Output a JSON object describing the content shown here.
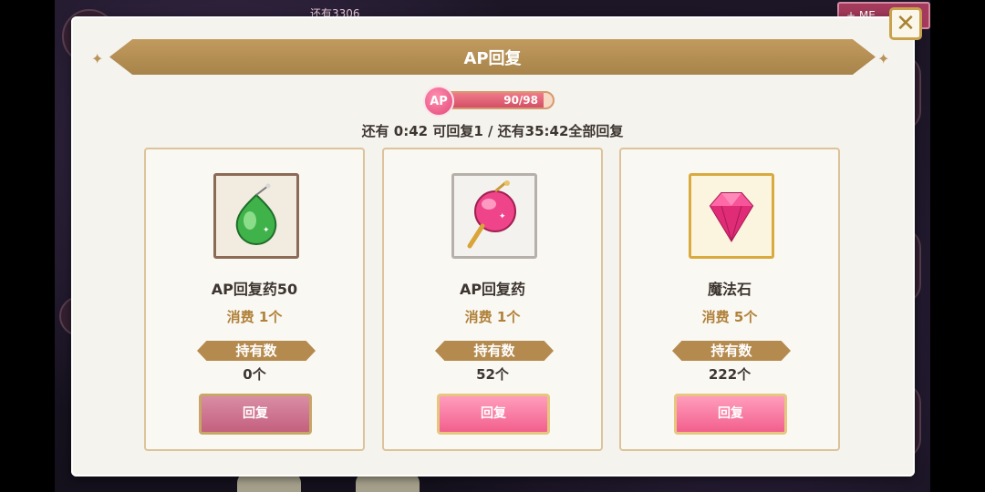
{
  "background": {
    "top_text": "还有3306",
    "tag_text": "+ ME"
  },
  "dialog": {
    "title": "AP回复",
    "ap": {
      "badge": "AP",
      "value_text": "90/98",
      "current": 90,
      "max": 98
    },
    "recover_info": "还有 0:42 可回复1 / 还有35:42全部回复",
    "close_glyph": "✕",
    "items": [
      {
        "name": "AP回复药50",
        "cost": "消费 1个",
        "own_label": "持有数",
        "own_count": "0个",
        "button": "回复",
        "icon": "green-potion-icon",
        "button_state": "disabled"
      },
      {
        "name": "AP回复药",
        "cost": "消费 1个",
        "own_label": "持有数",
        "own_count": "52个",
        "button": "回复",
        "icon": "pink-potion-icon",
        "button_state": "enabled"
      },
      {
        "name": "魔法石",
        "cost": "消费 5个",
        "own_label": "持有数",
        "own_count": "222个",
        "button": "回复",
        "icon": "magic-stone-icon",
        "button_state": "enabled"
      }
    ]
  },
  "colors": {
    "ribbon": "#b08b52",
    "accent_pink": "#f25f8d",
    "cost_text": "#b0813a"
  }
}
